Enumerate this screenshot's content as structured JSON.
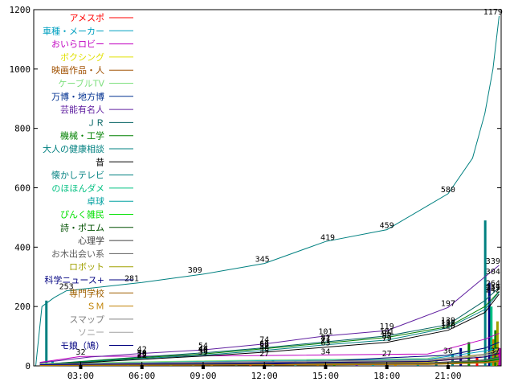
{
  "chart_data": {
    "type": "line",
    "title": "",
    "xlabel": "",
    "ylabel": "",
    "x_range_hours": [
      0.7,
      23.6
    ],
    "xlim": [
      "00:42",
      "23:36"
    ],
    "ylim": [
      0,
      1200
    ],
    "y_ticks": [
      0,
      200,
      400,
      600,
      800,
      1000,
      1200
    ],
    "x_ticks": [
      "03:00",
      "06:00",
      "09:00",
      "12:00",
      "15:00",
      "18:00",
      "21:00"
    ],
    "grid": false,
    "legend_position": "top-left",
    "series": [
      {
        "name": "アメスポ",
        "color": "#ff0000",
        "points": [
          [
            1,
            5
          ],
          [
            12,
            10
          ],
          [
            20,
            14
          ],
          [
            22.8,
            30
          ],
          [
            23.5,
            40
          ]
        ]
      },
      {
        "name": "車種・メーカー",
        "color": "#00a0c0",
        "points": [
          [
            1,
            8
          ],
          [
            12,
            18
          ],
          [
            20,
            22
          ],
          [
            22.8,
            50
          ],
          [
            23.5,
            60
          ]
        ]
      },
      {
        "name": "おいらロビー",
        "color": "#c000c0",
        "points": [
          [
            1,
            12
          ],
          [
            3,
            32
          ],
          [
            12,
            35
          ],
          [
            20,
            40
          ],
          [
            22.8,
            90
          ],
          [
            23.5,
            110
          ]
        ]
      },
      {
        "name": "ボクシング",
        "color": "#e0e000",
        "points": [
          [
            1,
            4
          ],
          [
            12,
            8
          ],
          [
            20,
            12
          ],
          [
            22.8,
            40
          ],
          [
            23.5,
            60
          ]
        ]
      },
      {
        "name": "映画作品・人",
        "color": "#a05000",
        "points": [
          [
            1,
            6
          ],
          [
            12,
            12
          ],
          [
            20,
            16
          ],
          [
            22.8,
            35
          ],
          [
            23.5,
            50
          ]
        ]
      },
      {
        "name": "ケーブルTV",
        "color": "#80e080",
        "points": [
          [
            1,
            8
          ],
          [
            12,
            20
          ],
          [
            20,
            25
          ],
          [
            22.8,
            60
          ],
          [
            23.5,
            80
          ]
        ]
      },
      {
        "name": "万博・地方博",
        "color": "#003090",
        "points": [
          [
            1,
            2
          ],
          [
            12,
            4
          ],
          [
            20,
            6
          ],
          [
            22.8,
            10
          ],
          [
            23.5,
            15
          ]
        ]
      },
      {
        "name": "芸能有名人",
        "color": "#6020a0",
        "points": [
          [
            1,
            10
          ],
          [
            3.5,
            30
          ],
          [
            6,
            42
          ],
          [
            9,
            54
          ],
          [
            12,
            74
          ],
          [
            15,
            101
          ],
          [
            18,
            119
          ],
          [
            21,
            197
          ],
          [
            22.8,
            300
          ],
          [
            23.5,
            339
          ]
        ]
      },
      {
        "name": "ＪＲ",
        "color": "#006060",
        "points": [
          [
            1,
            5
          ],
          [
            6,
            30
          ],
          [
            9,
            44
          ],
          [
            12,
            61
          ],
          [
            15,
            81
          ],
          [
            18,
            101
          ],
          [
            21,
            139
          ],
          [
            22.8,
            220
          ],
          [
            23.5,
            264
          ]
        ]
      },
      {
        "name": "機械・工学",
        "color": "#008000",
        "points": [
          [
            1,
            5
          ],
          [
            6,
            28
          ],
          [
            9,
            40
          ],
          [
            12,
            58
          ],
          [
            15,
            77
          ],
          [
            18,
            96
          ],
          [
            21,
            132
          ],
          [
            22.8,
            200
          ],
          [
            23.5,
            251
          ]
        ]
      },
      {
        "name": "大人の健康相談",
        "color": "#008080",
        "points": [
          [
            1,
            4
          ],
          [
            6,
            25
          ],
          [
            9,
            36
          ],
          [
            12,
            52
          ],
          [
            15,
            71
          ],
          [
            18,
            87
          ],
          [
            21,
            128
          ],
          [
            22.8,
            190
          ],
          [
            23.5,
            249
          ]
        ]
      },
      {
        "name": "昔",
        "color": "#000000",
        "points": [
          [
            1,
            3
          ],
          [
            6,
            22
          ],
          [
            9,
            33
          ],
          [
            12,
            46
          ],
          [
            15,
            63
          ],
          [
            18,
            79
          ],
          [
            21,
            120
          ],
          [
            22.8,
            180
          ],
          [
            23.5,
            242
          ]
        ]
      },
      {
        "name": "懐かしテレビ",
        "color": "#008080",
        "points": [
          [
            0.8,
            0
          ],
          [
            1.1,
            200
          ],
          [
            1.7,
            230
          ],
          [
            2.3,
            253
          ],
          [
            6,
            281
          ],
          [
            9,
            309
          ],
          [
            12,
            345
          ],
          [
            15,
            419
          ],
          [
            18,
            459
          ],
          [
            21,
            580
          ],
          [
            22.2,
            700
          ],
          [
            22.8,
            850
          ],
          [
            23.2,
            1000
          ],
          [
            23.5,
            1179
          ]
        ]
      },
      {
        "name": "のほほんダメ",
        "color": "#00c080",
        "points": [
          [
            1,
            2
          ],
          [
            12,
            6
          ],
          [
            20,
            8
          ],
          [
            22.8,
            20
          ],
          [
            23.5,
            30
          ]
        ]
      },
      {
        "name": "卓球",
        "color": "#00a0a0",
        "points": [
          [
            1,
            2
          ],
          [
            12,
            4
          ],
          [
            20,
            6
          ],
          [
            22.8,
            12
          ],
          [
            23.5,
            20
          ]
        ]
      },
      {
        "name": "ぴんく雑民",
        "color": "#00e000",
        "points": [
          [
            1,
            3
          ],
          [
            12,
            5
          ],
          [
            20,
            8
          ],
          [
            22.8,
            15
          ],
          [
            23.5,
            25
          ]
        ]
      },
      {
        "name": "詩・ポエム",
        "color": "#005000",
        "points": [
          [
            1,
            2
          ],
          [
            12,
            5
          ],
          [
            20,
            7
          ],
          [
            22.8,
            14
          ],
          [
            23.5,
            22
          ]
        ]
      },
      {
        "name": "心理学",
        "color": "#404040",
        "points": [
          [
            1,
            4
          ],
          [
            12,
            8
          ],
          [
            20,
            10
          ],
          [
            22.8,
            20
          ],
          [
            23.5,
            30
          ]
        ]
      },
      {
        "name": "お木出会い系",
        "color": "#606060",
        "points": [
          [
            1,
            3
          ],
          [
            12,
            6
          ],
          [
            20,
            9
          ],
          [
            22.8,
            18
          ],
          [
            23.5,
            28
          ]
        ]
      },
      {
        "name": "ロボット",
        "color": "#a0a000",
        "points": [
          [
            1,
            1
          ],
          [
            12,
            3
          ],
          [
            20,
            5
          ],
          [
            22.8,
            10
          ],
          [
            23.5,
            14
          ]
        ]
      },
      {
        "name": "科学ニュース+",
        "color": "#000080",
        "points": [
          [
            1,
            2
          ],
          [
            12,
            5
          ],
          [
            18,
            27
          ],
          [
            21,
            36
          ],
          [
            22.8,
            60
          ],
          [
            23.5,
            80
          ]
        ]
      },
      {
        "name": "専門学校",
        "color": "#a06000",
        "points": [
          [
            1,
            1
          ],
          [
            12,
            3
          ],
          [
            20,
            5
          ],
          [
            22.8,
            10
          ],
          [
            23.5,
            16
          ]
        ]
      },
      {
        "name": "ＳＭ",
        "color": "#c08000",
        "points": [
          [
            1,
            2
          ],
          [
            12,
            4
          ],
          [
            20,
            6
          ],
          [
            22.8,
            12
          ],
          [
            23.5,
            18
          ]
        ]
      },
      {
        "name": "スマップ",
        "color": "#808080",
        "points": [
          [
            1,
            6
          ],
          [
            12,
            15
          ],
          [
            20,
            20
          ],
          [
            22.8,
            40
          ],
          [
            23.5,
            55
          ]
        ]
      },
      {
        "name": "ソニー",
        "color": "#a0a0a0",
        "points": [
          [
            1,
            5
          ],
          [
            12,
            12
          ],
          [
            20,
            18
          ],
          [
            22.8,
            35
          ],
          [
            23.5,
            48
          ]
        ]
      },
      {
        "name": "モ娘（鳩）",
        "color": "#000080",
        "points": [
          [
            1,
            4
          ],
          [
            12,
            10
          ],
          [
            20,
            15
          ],
          [
            22.8,
            30
          ],
          [
            23.5,
            42
          ]
        ]
      }
    ],
    "data_labels": [
      {
        "x": 2.3,
        "y": 253,
        "text": "253"
      },
      {
        "x": 5.5,
        "y": 281,
        "text": "281"
      },
      {
        "x": 8.6,
        "y": 309,
        "text": "309"
      },
      {
        "x": 11.9,
        "y": 345,
        "text": "345"
      },
      {
        "x": 15.1,
        "y": 419,
        "text": "419"
      },
      {
        "x": 18.0,
        "y": 459,
        "text": "459"
      },
      {
        "x": 21.0,
        "y": 580,
        "text": "580"
      },
      {
        "x": 23.2,
        "y": 1179,
        "text": "1179"
      },
      {
        "x": 23.2,
        "y": 339,
        "text": "339"
      },
      {
        "x": 23.2,
        "y": 304,
        "text": "304"
      },
      {
        "x": 23.2,
        "y": 264,
        "text": "264"
      },
      {
        "x": 23.2,
        "y": 251,
        "text": "251"
      },
      {
        "x": 23.2,
        "y": 249,
        "text": "249"
      },
      {
        "x": 23.2,
        "y": 242,
        "text": "242"
      },
      {
        "x": 21.0,
        "y": 197,
        "text": "197"
      },
      {
        "x": 21.0,
        "y": 139,
        "text": "139"
      },
      {
        "x": 21.0,
        "y": 132,
        "text": "132"
      },
      {
        "x": 21.0,
        "y": 128,
        "text": "128"
      },
      {
        "x": 21.0,
        "y": 120,
        "text": "120"
      },
      {
        "x": 18.0,
        "y": 119,
        "text": "119"
      },
      {
        "x": 18.0,
        "y": 101,
        "text": "101"
      },
      {
        "x": 18.0,
        "y": 96,
        "text": "96"
      },
      {
        "x": 18.0,
        "y": 87,
        "text": "87"
      },
      {
        "x": 18.0,
        "y": 79,
        "text": "79"
      },
      {
        "x": 18.0,
        "y": 27,
        "text": "27"
      },
      {
        "x": 15.0,
        "y": 101,
        "text": "101"
      },
      {
        "x": 15.0,
        "y": 81,
        "text": "81"
      },
      {
        "x": 15.0,
        "y": 77,
        "text": "77"
      },
      {
        "x": 15.0,
        "y": 71,
        "text": "71"
      },
      {
        "x": 15.0,
        "y": 63,
        "text": "63"
      },
      {
        "x": 15.0,
        "y": 34,
        "text": "34"
      },
      {
        "x": 12.0,
        "y": 74,
        "text": "74"
      },
      {
        "x": 12.0,
        "y": 61,
        "text": "61"
      },
      {
        "x": 12.0,
        "y": 58,
        "text": "58"
      },
      {
        "x": 12.0,
        "y": 52,
        "text": "52"
      },
      {
        "x": 12.0,
        "y": 46,
        "text": "46"
      },
      {
        "x": 12.0,
        "y": 27,
        "text": "27"
      },
      {
        "x": 9.0,
        "y": 54,
        "text": "54"
      },
      {
        "x": 9.0,
        "y": 44,
        "text": "44"
      },
      {
        "x": 9.0,
        "y": 40,
        "text": "40"
      },
      {
        "x": 9.0,
        "y": 36,
        "text": "36"
      },
      {
        "x": 9.0,
        "y": 33,
        "text": "33"
      },
      {
        "x": 6.0,
        "y": 42,
        "text": "42"
      },
      {
        "x": 6.0,
        "y": 30,
        "text": "30"
      },
      {
        "x": 6.0,
        "y": 28,
        "text": "28"
      },
      {
        "x": 6.0,
        "y": 25,
        "text": "25"
      },
      {
        "x": 6.0,
        "y": 22,
        "text": "22"
      },
      {
        "x": 3.0,
        "y": 32,
        "text": "32"
      },
      {
        "x": 21.0,
        "y": 36,
        "text": "36"
      },
      {
        "x": 23.3,
        "y": 37,
        "text": "37"
      }
    ],
    "bars": [
      {
        "x": 1.3,
        "v": 220,
        "c": "#008080"
      },
      {
        "x": 1.6,
        "v": 15,
        "c": "#00a0c0"
      },
      {
        "x": 2.4,
        "v": 10,
        "c": "#006060"
      },
      {
        "x": 3.2,
        "v": 6,
        "c": "#c000c0"
      },
      {
        "x": 4.1,
        "v": 8,
        "c": "#008000"
      },
      {
        "x": 5.3,
        "v": 5,
        "c": "#808080"
      },
      {
        "x": 6.2,
        "v": 7,
        "c": "#6020a0"
      },
      {
        "x": 7.4,
        "v": 6,
        "c": "#00e000"
      },
      {
        "x": 8.5,
        "v": 9,
        "c": "#008080"
      },
      {
        "x": 9.4,
        "v": 10,
        "c": "#a05000"
      },
      {
        "x": 10.6,
        "v": 8,
        "c": "#006060"
      },
      {
        "x": 11.3,
        "v": 12,
        "c": "#ff0000"
      },
      {
        "x": 12.4,
        "v": 20,
        "c": "#008080"
      },
      {
        "x": 13.5,
        "v": 15,
        "c": "#00a0c0"
      },
      {
        "x": 14.6,
        "v": 10,
        "c": "#a06000"
      },
      {
        "x": 15.4,
        "v": 12,
        "c": "#008000"
      },
      {
        "x": 16.5,
        "v": 9,
        "c": "#6020a0"
      },
      {
        "x": 17.3,
        "v": 14,
        "c": "#00a0a0"
      },
      {
        "x": 18.4,
        "v": 11,
        "c": "#c08000"
      },
      {
        "x": 19.5,
        "v": 16,
        "c": "#008080"
      },
      {
        "x": 20.4,
        "v": 18,
        "c": "#006060"
      },
      {
        "x": 21.2,
        "v": 40,
        "c": "#008080"
      },
      {
        "x": 21.6,
        "v": 60,
        "c": "#000080"
      },
      {
        "x": 22.0,
        "v": 80,
        "c": "#008000"
      },
      {
        "x": 22.4,
        "v": 30,
        "c": "#ff0000"
      },
      {
        "x": 22.8,
        "v": 490,
        "c": "#008080"
      },
      {
        "x": 23.0,
        "v": 280,
        "c": "#000080"
      },
      {
        "x": 23.1,
        "v": 200,
        "c": "#00c080"
      },
      {
        "x": 23.2,
        "v": 90,
        "c": "#c08000"
      },
      {
        "x": 23.3,
        "v": 120,
        "c": "#008000"
      },
      {
        "x": 23.4,
        "v": 150,
        "c": "#a0a000"
      },
      {
        "x": 23.5,
        "v": 60,
        "c": "#c000c0"
      }
    ]
  }
}
